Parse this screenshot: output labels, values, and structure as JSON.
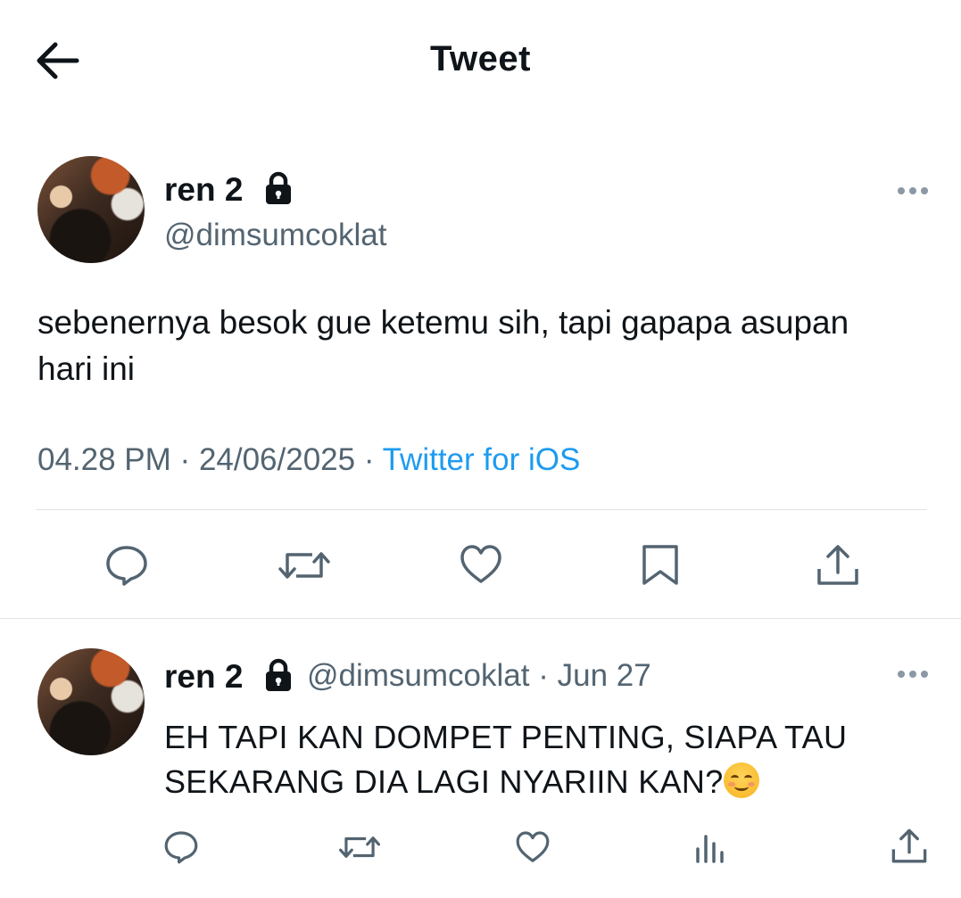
{
  "header": {
    "title": "Tweet"
  },
  "main_tweet": {
    "display_name": "ren 2",
    "handle": "@dimsumcoklat",
    "text": "sebenernya besok gue ketemu sih, tapi gapapa asupan hari ini",
    "time": "04.28 PM",
    "date": "24/06/2025",
    "separator": "·",
    "source": "Twitter for iOS",
    "actions": [
      "reply-icon",
      "retweet-icon",
      "like-icon",
      "bookmark-icon",
      "share-icon"
    ]
  },
  "reply": {
    "display_name": "ren 2",
    "handle": "@dimsumcoklat",
    "separator": "·",
    "date": "Jun 27",
    "text": "EH TAPI KAN DOMPET PENTING, SIAPA TAU SEKARANG DIA LAGI NYARIIN KAN?",
    "emoji": "☺️",
    "actions": [
      "reply-icon",
      "retweet-icon",
      "like-icon",
      "views-icon",
      "share-icon"
    ]
  },
  "colors": {
    "accent": "#1d9bf0",
    "secondary_text": "#536471",
    "icon": "#536471"
  }
}
